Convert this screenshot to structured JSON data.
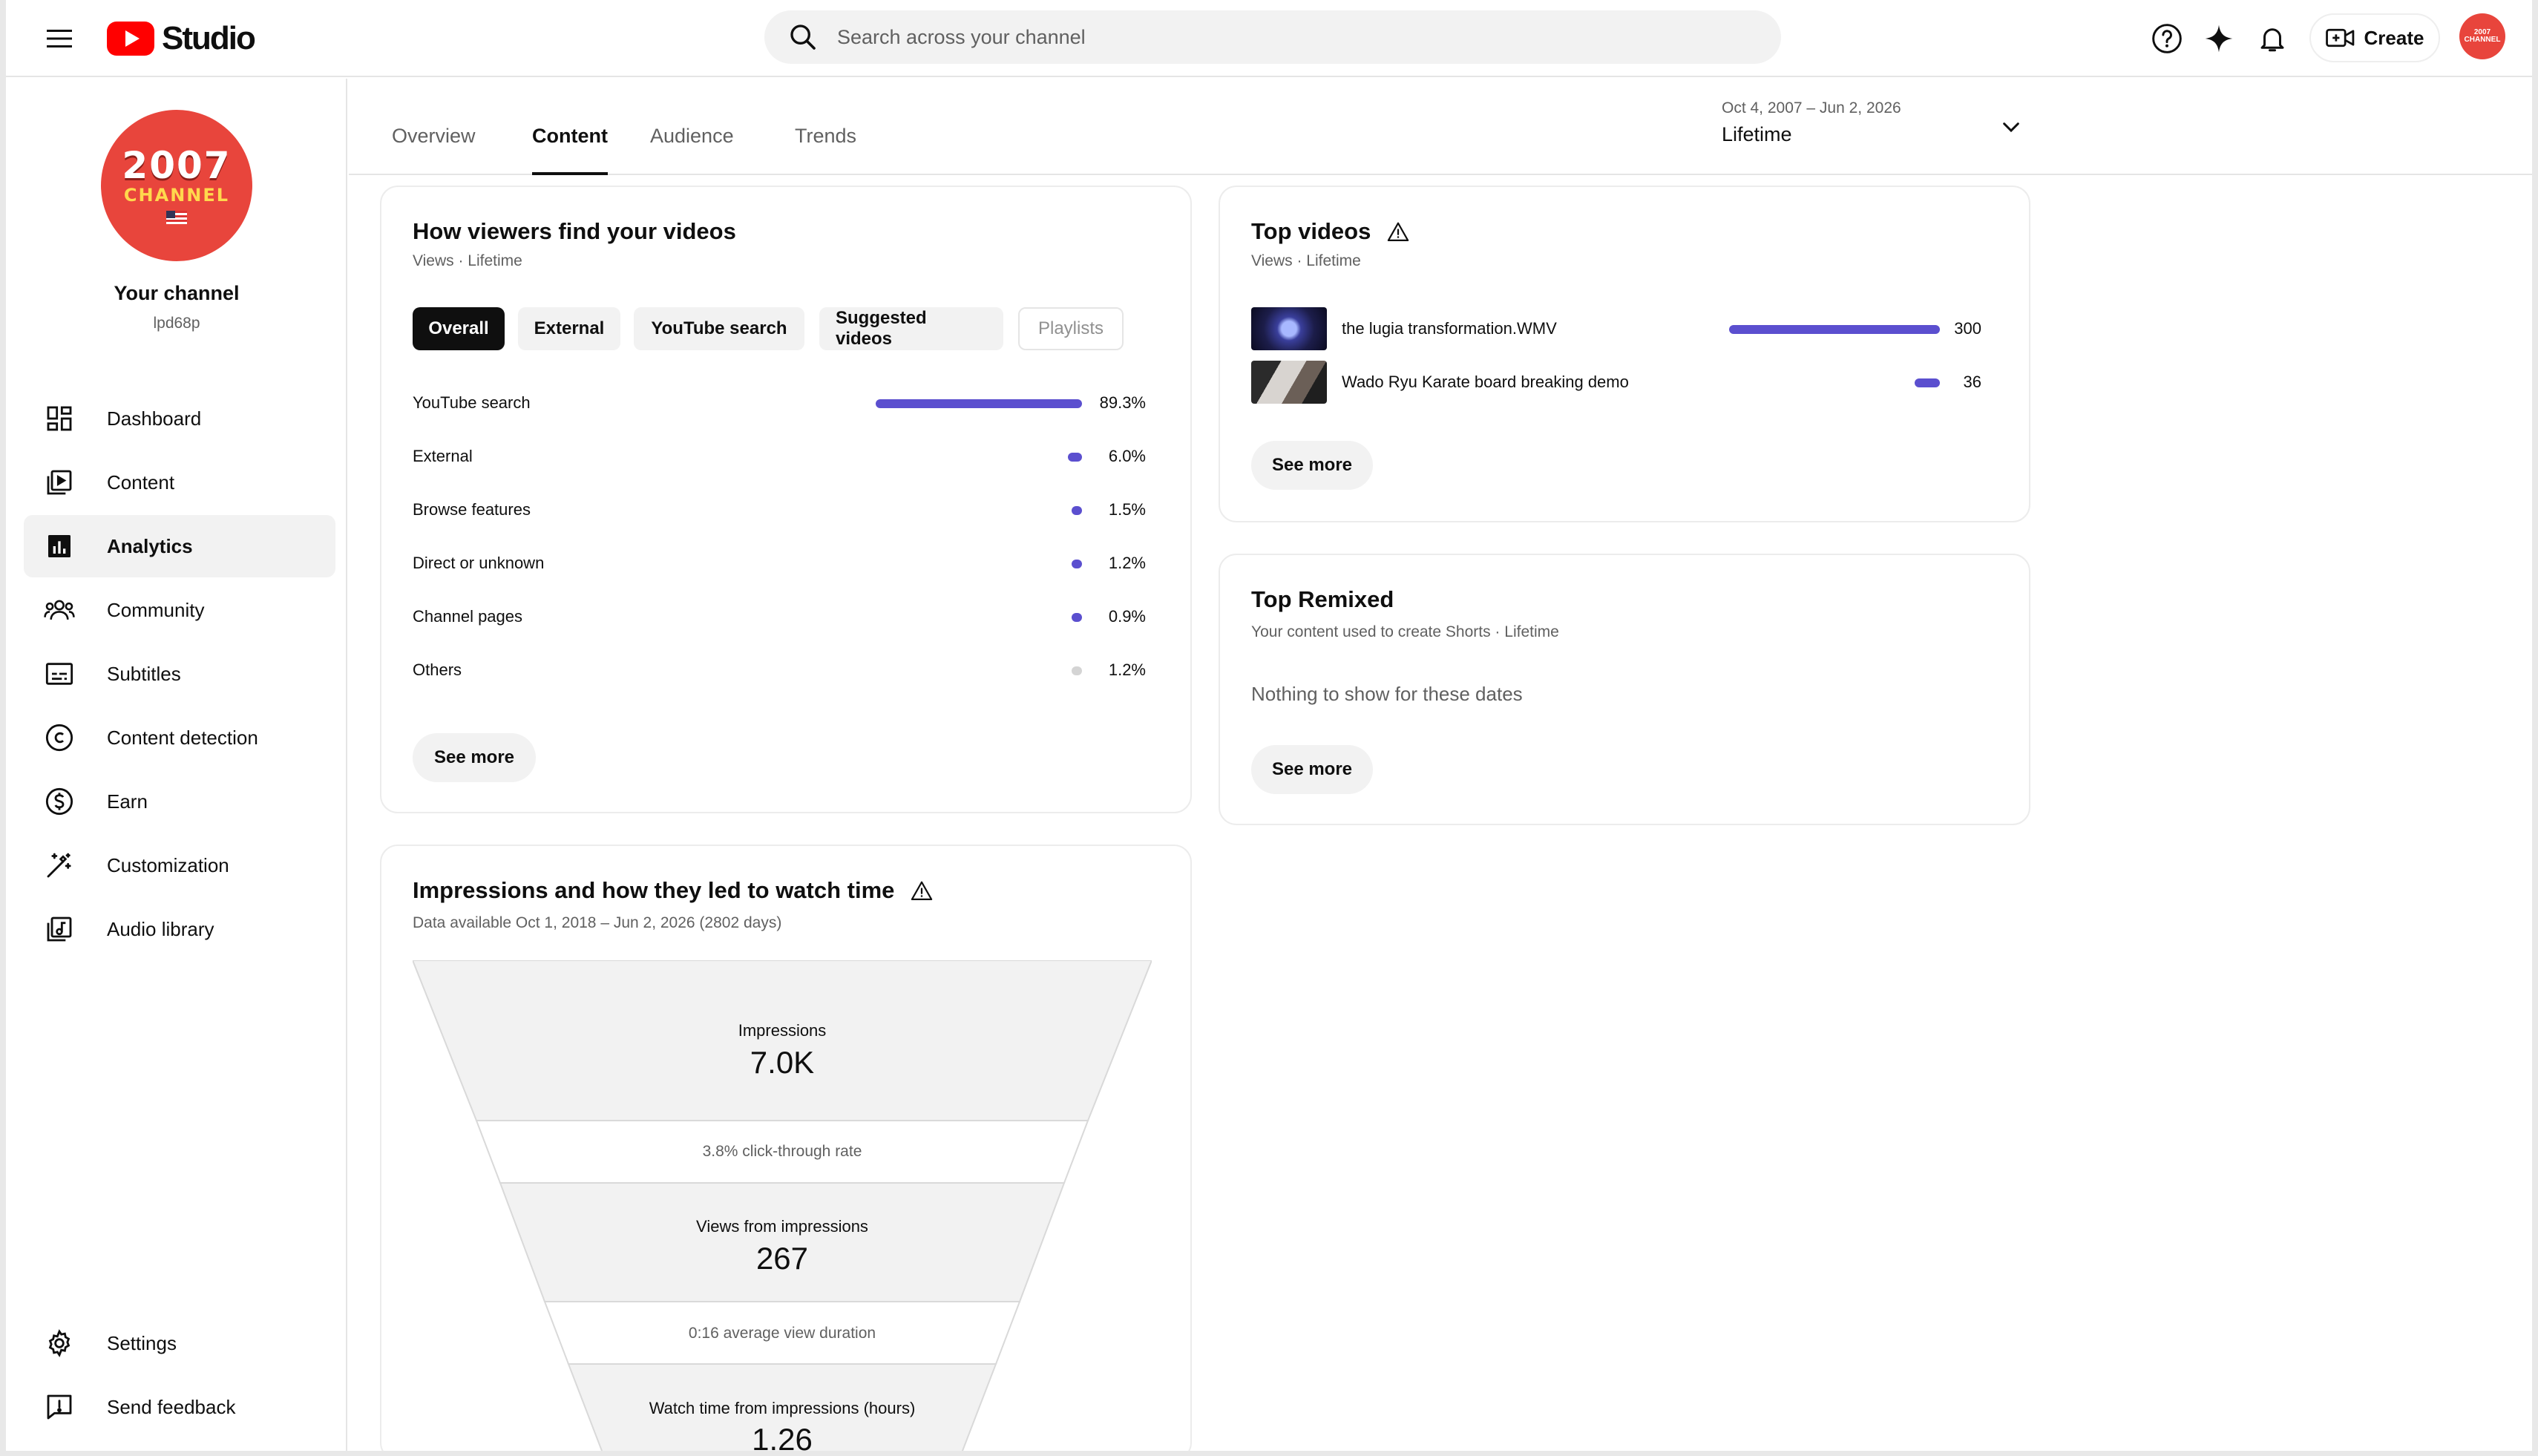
{
  "header": {
    "logo_text": "Studio",
    "search_placeholder": "Search across your channel",
    "create_label": "Create",
    "avatar_text": "2007 CHANNEL"
  },
  "channel": {
    "avatar_year": "2007",
    "avatar_word": "CHANNEL",
    "title": "Your channel",
    "handle": "lpd68p"
  },
  "sidebar": {
    "items": [
      {
        "label": "Dashboard",
        "icon": "dashboard-icon"
      },
      {
        "label": "Content",
        "icon": "content-icon"
      },
      {
        "label": "Analytics",
        "icon": "analytics-icon",
        "active": true
      },
      {
        "label": "Community",
        "icon": "community-icon"
      },
      {
        "label": "Subtitles",
        "icon": "subtitles-icon"
      },
      {
        "label": "Content detection",
        "icon": "copyright-icon"
      },
      {
        "label": "Earn",
        "icon": "dollar-icon"
      },
      {
        "label": "Customization",
        "icon": "magic-wand-icon"
      },
      {
        "label": "Audio library",
        "icon": "audio-library-icon"
      }
    ],
    "settings_label": "Settings",
    "feedback_label": "Send feedback"
  },
  "tabs": {
    "items": [
      "Overview",
      "Content",
      "Audience",
      "Trends"
    ],
    "active": "Content"
  },
  "date": {
    "range": "Oct 4, 2007 – Jun 2, 2026",
    "label": "Lifetime"
  },
  "viewers_card": {
    "title": "How viewers find your videos",
    "subtitle": "Views · Lifetime",
    "chips": [
      "Overall",
      "External",
      "YouTube search",
      "Suggested videos",
      "Playlists"
    ],
    "rows": [
      {
        "label": "YouTube search",
        "value": "89.3%",
        "pct": 89.3
      },
      {
        "label": "External",
        "value": "6.0%",
        "pct": 6.0
      },
      {
        "label": "Browse features",
        "value": "1.5%",
        "pct": 1.5
      },
      {
        "label": "Direct or unknown",
        "value": "1.2%",
        "pct": 1.2
      },
      {
        "label": "Channel pages",
        "value": "0.9%",
        "pct": 0.9
      },
      {
        "label": "Others",
        "value": "1.2%",
        "pct": 1.2
      }
    ],
    "see_more": "See more"
  },
  "top_videos": {
    "title": "Top videos",
    "subtitle": "Views · Lifetime",
    "videos": [
      {
        "title": "the lugia transformation.WMV",
        "views": "300",
        "views_num": 300
      },
      {
        "title": "Wado Ryu Karate board breaking demo",
        "views": "36",
        "views_num": 36
      }
    ],
    "see_more": "See more"
  },
  "top_remixed": {
    "title": "Top Remixed",
    "subtitle": "Your content used to create Shorts · Lifetime",
    "empty": "Nothing to show for these dates",
    "see_more": "See more"
  },
  "impressions": {
    "title": "Impressions and how they led to watch time",
    "subtitle": "Data available Oct 1, 2018 – Jun 2, 2026 (2802 days)",
    "impressions_label": "Impressions",
    "impressions_value": "7.0K",
    "ctr": "3.8% click-through rate",
    "views_label": "Views from impressions",
    "views_value": "267",
    "avd": "0:16 average view duration",
    "watch_label": "Watch time from impressions (hours)",
    "watch_value": "1.26"
  },
  "colors": {
    "accent": "#5b4fcf",
    "brand_red": "#ff0000",
    "avatar_red": "#e8453c"
  }
}
